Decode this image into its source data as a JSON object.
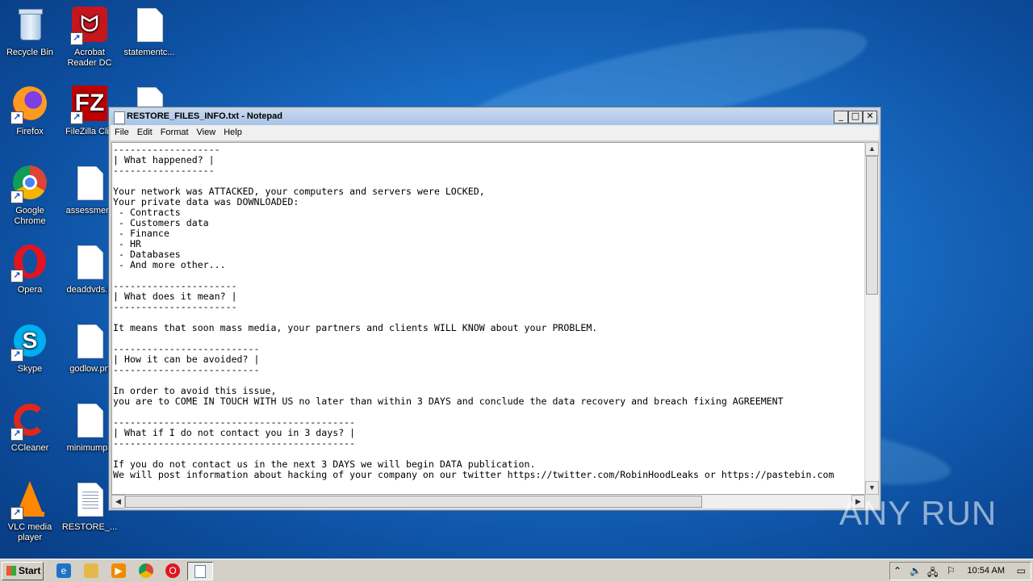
{
  "desktop": {
    "icons": [
      {
        "label": "Recycle Bin",
        "icon": "recycle-bin-icon"
      },
      {
        "label": "Acrobat Reader DC",
        "icon": "acrobat-icon"
      },
      {
        "label": "statementc...",
        "icon": "file-icon"
      },
      {
        "label": "Firefox",
        "icon": "firefox-icon"
      },
      {
        "label": "FileZilla Clie",
        "icon": "filezilla-icon"
      },
      {
        "label": "Google Chrome",
        "icon": "chrome-icon"
      },
      {
        "label": "assessment",
        "icon": "file-icon"
      },
      {
        "label": "Opera",
        "icon": "opera-icon"
      },
      {
        "label": "deaddvds.p",
        "icon": "file-icon"
      },
      {
        "label": "Skype",
        "icon": "skype-icon"
      },
      {
        "label": "godlow.pn",
        "icon": "file-icon"
      },
      {
        "label": "CCleaner",
        "icon": "ccleaner-icon"
      },
      {
        "label": "minimumpa",
        "icon": "file-icon"
      },
      {
        "label": "VLC media player",
        "icon": "vlc-icon"
      },
      {
        "label": "RESTORE_...",
        "icon": "text-file-icon"
      }
    ]
  },
  "window": {
    "title": "RESTORE_FILES_INFO.txt - Notepad",
    "buttons": {
      "minimize": "_",
      "maximize": "□",
      "close": "✕"
    },
    "menu": [
      "File",
      "Edit",
      "Format",
      "View",
      "Help"
    ],
    "content": [
      "-------------------",
      "| What happened? |",
      "------------------",
      "",
      "Your network was ATTACKED, your computers and servers were LOCKED,",
      "Your private data was DOWNLOADED:",
      " - Contracts",
      " - Customers data",
      " - Finance",
      " - HR",
      " - Databases",
      " - And more other...",
      "",
      "----------------------",
      "| What does it mean? |",
      "----------------------",
      "",
      "It means that soon mass media, your partners and clients WILL KNOW about your PROBLEM.",
      "",
      "--------------------------",
      "| How it can be avoided? |",
      "--------------------------",
      "",
      "In order to avoid this issue,",
      "you are to COME IN TOUCH WITH US no later than within 3 DAYS and conclude the data recovery and breach fixing AGREEMENT",
      "",
      "-------------------------------------------",
      "| What if I do not contact you in 3 days? |",
      "-------------------------------------------",
      "",
      "If you do not contact us in the next 3 DAYS we will begin DATA publication.",
      "We will post information about hacking of your company on our twitter https://twitter.com/RobinHoodLeaks or https://pastebin.com"
    ]
  },
  "watermark": "ANY RUN",
  "taskbar": {
    "start_label": "Start",
    "clock": "10:54 AM"
  }
}
